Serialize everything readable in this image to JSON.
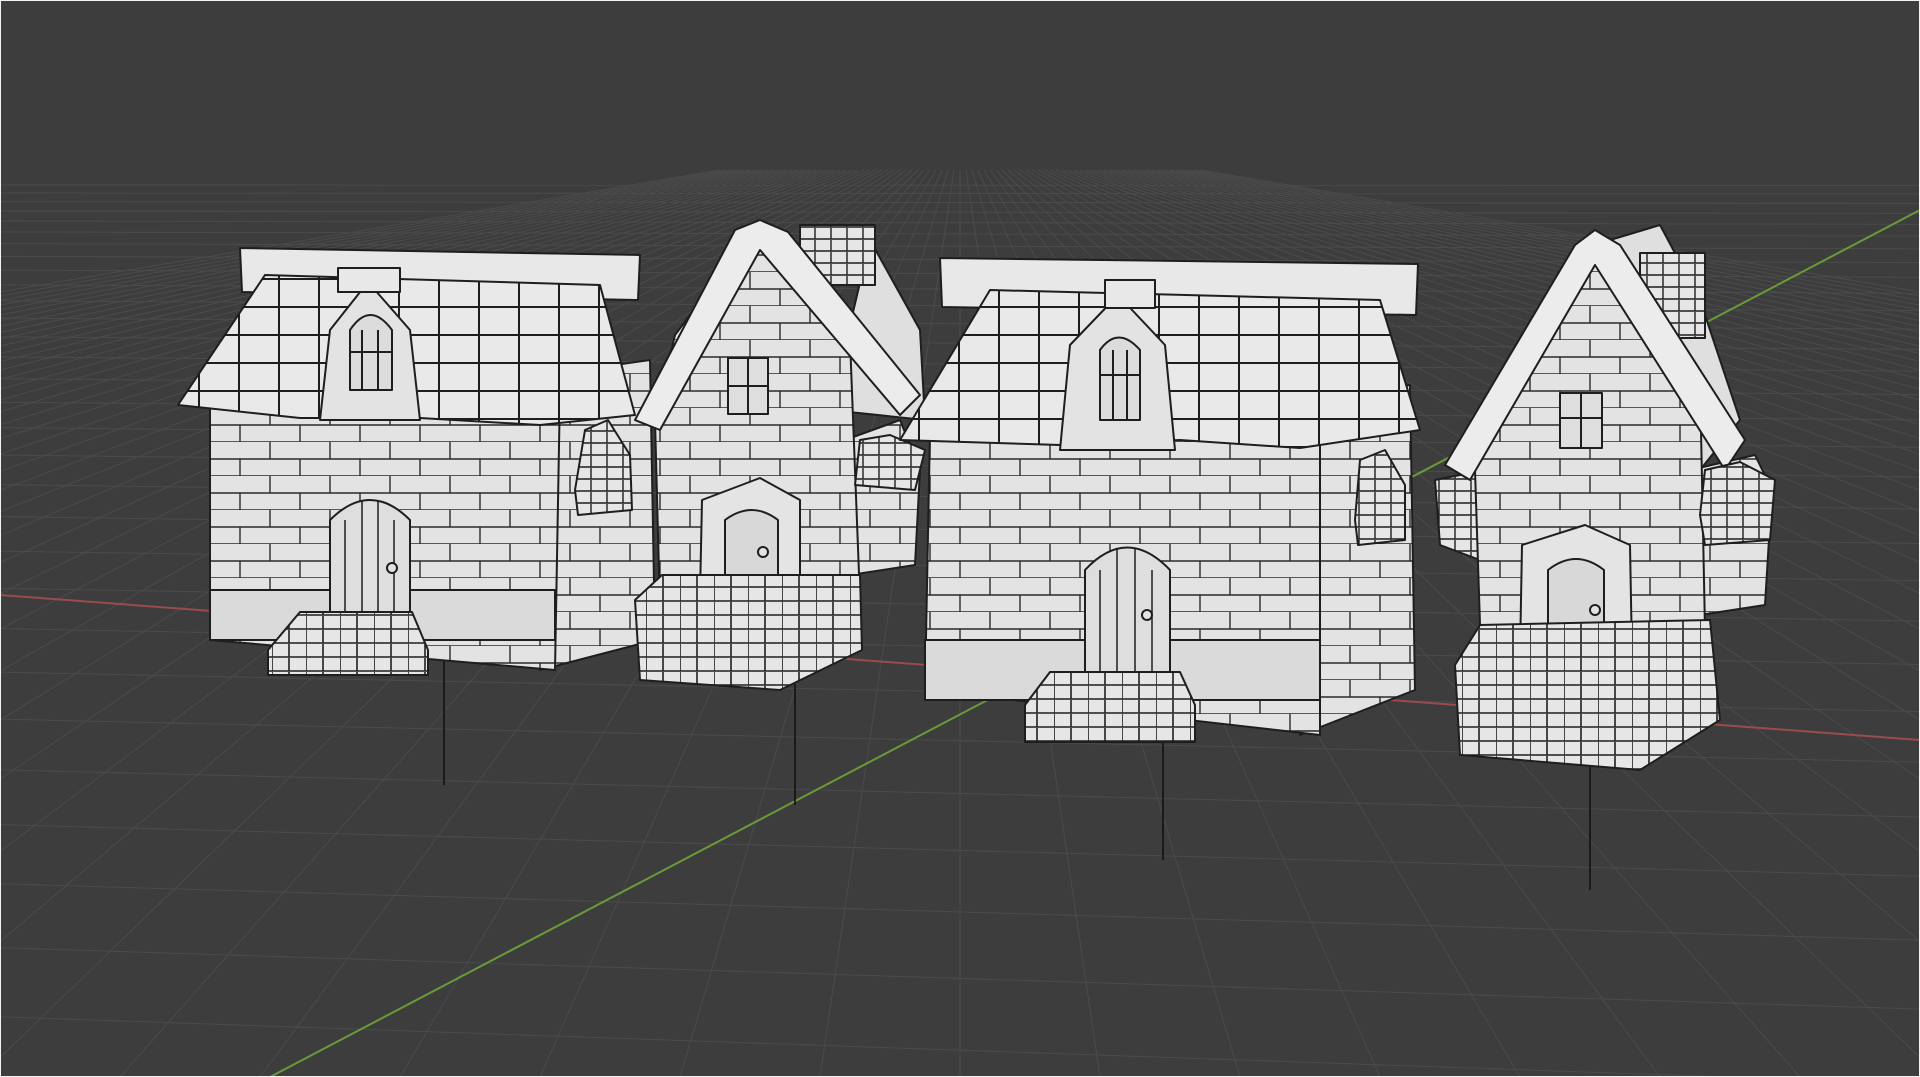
{
  "app": {
    "viewport_mode": "solid-shading",
    "background_color": "#3d3d3d",
    "grid_color": "#4b4b4b",
    "x_axis_color": "#9a4b4b",
    "y_axis_color": "#6a9a3a",
    "mesh_fill": "#e3e3e3",
    "mesh_edge": "#1e1e1e"
  },
  "objects": [
    {
      "id": "house-1",
      "type": "wide-house-with-dormer"
    },
    {
      "id": "house-2",
      "type": "narrow-pointed-house"
    },
    {
      "id": "house-3",
      "type": "wide-house-with-dormer"
    },
    {
      "id": "house-4",
      "type": "narrow-pointed-house"
    }
  ]
}
